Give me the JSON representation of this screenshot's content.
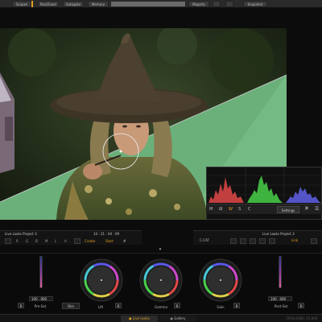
{
  "toolbar": {
    "scopes": "Scopes",
    "panzoom": "Pan/Zoom",
    "autogate": "Autogate",
    "memory": "Memory",
    "magnify": "Magnify",
    "btn_a": "<",
    "btn_b": ">",
    "snapshot": "Snapshot"
  },
  "scopes": {
    "settings": "Settings",
    "close": "✕",
    "menu": "☰",
    "icons": [
      "M",
      "⚄",
      "W",
      "S",
      "C"
    ],
    "colors": {
      "red": "#e04848",
      "green": "#48d048",
      "blue": "#6060e8"
    }
  },
  "left_strip": {
    "project": "Live Looks Project 3",
    "timecode": "14 : 21 : 04 : 09",
    "buttons": [
      "R",
      "G",
      "B",
      "M",
      "L",
      "A"
    ],
    "create": "Create",
    "start": "Start",
    "hash": "#"
  },
  "right_strip": {
    "project": "Live Looks Project 3",
    "ccat": "C-CAT",
    "link": "Link"
  },
  "expand": "▾",
  "wheels": {
    "presat_value": "100 . 000",
    "presat_label": "Pre-Sat",
    "dim_label": "Dim",
    "lift_label": "Lift",
    "gamma_label": "Gamma",
    "gain_label": "Gain",
    "postsat_value": "100 . 000",
    "postsat_label": "Post-Sat",
    "reset": "R"
  },
  "bottom": {
    "livelooks": "Live Looks",
    "gallery": "Gallery",
    "resolution": "1920x1080, 25.000"
  }
}
